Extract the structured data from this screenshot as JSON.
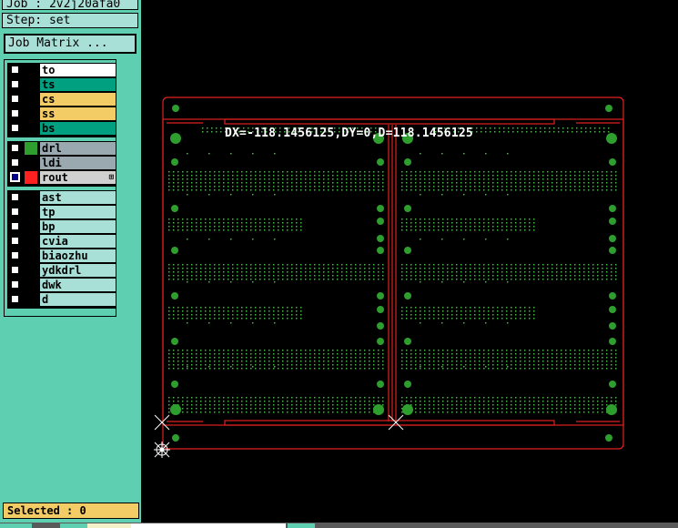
{
  "header": {
    "job": "Job : 2v2j20afa0",
    "step": "Step: set"
  },
  "job_matrix_button": "Job Matrix ...",
  "layers": {
    "group1": [
      {
        "name": "to",
        "color": "#ffffff"
      },
      {
        "name": "ts",
        "color": "#00a080"
      },
      {
        "name": "cs",
        "color": "#f4cc66"
      },
      {
        "name": "ss",
        "color": "#f4cc66"
      },
      {
        "name": "bs",
        "color": "#00a080"
      }
    ],
    "group2": [
      {
        "name": "drl",
        "color": "#9aa8b0",
        "swatch": "#2e9e2e"
      },
      {
        "name": "ldi",
        "color": "#9aa8b0"
      },
      {
        "name": "rout",
        "color": "#d0d0d0",
        "swatch": "#ff2020",
        "selected": true,
        "marker": "⊞"
      }
    ],
    "group3": [
      {
        "name": "ast",
        "color": "#a8e0d8"
      },
      {
        "name": "tp",
        "color": "#a8e0d8"
      },
      {
        "name": "bp",
        "color": "#a8e0d8"
      },
      {
        "name": "cvia",
        "color": "#a8e0d8"
      },
      {
        "name": "biaozhu",
        "color": "#a8e0d8"
      },
      {
        "name": "ydkdrl",
        "color": "#a8e0d8"
      },
      {
        "name": "dwk",
        "color": "#a8e0d8"
      },
      {
        "name": "d",
        "color": "#a8e0d8"
      }
    ]
  },
  "status": {
    "selected": "Selected : 0"
  },
  "measurement": "DX=-118.1456125,DY=0,D=118.1456125",
  "colors": {
    "sidebar": "#5fcfb2",
    "outline": "#e02020",
    "pads": "#2e9e2e",
    "dots": "#46b846",
    "measure_text": "#ffffff"
  }
}
